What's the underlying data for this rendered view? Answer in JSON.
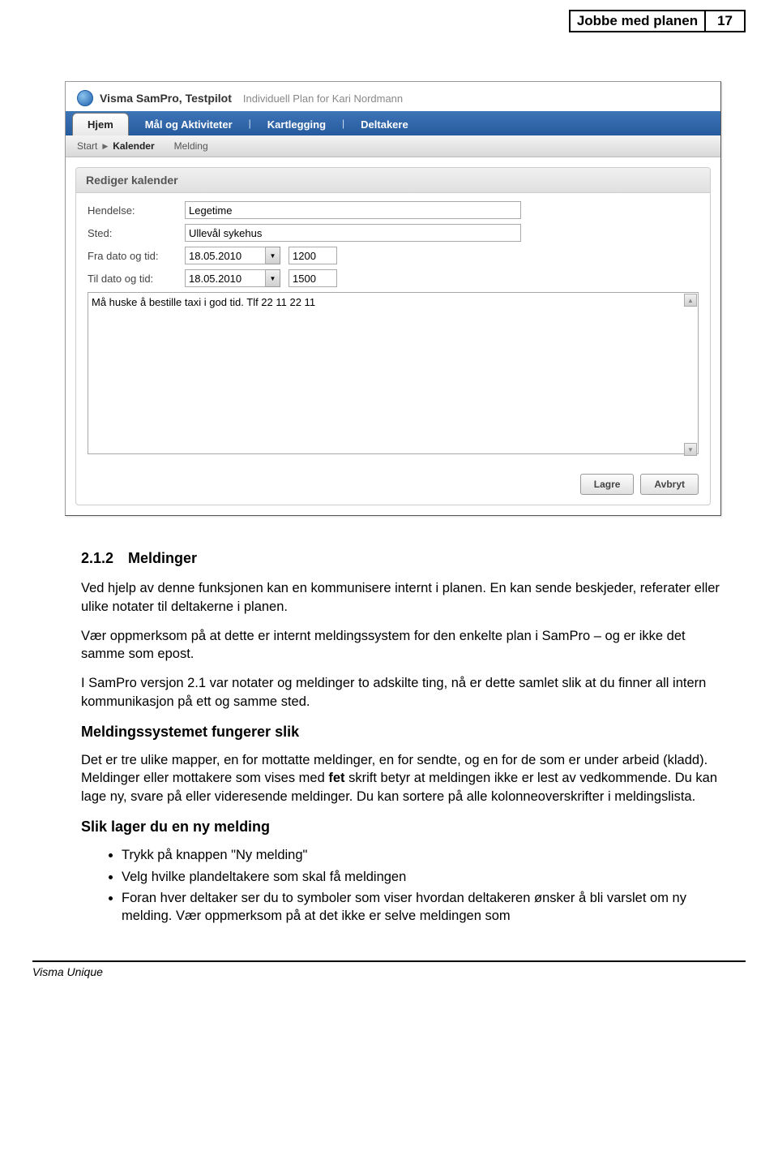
{
  "header": {
    "title": "Jobbe med planen",
    "page_number": "17"
  },
  "app": {
    "name": "Visma SamPro, Testpilot",
    "subtitle": "Individuell Plan for Kari Nordmann",
    "tabs": [
      "Hjem",
      "Mål og Aktiviteter",
      "Kartlegging",
      "Deltakere"
    ],
    "subtabs": {
      "start": "Start",
      "kalender": "Kalender",
      "melding": "Melding"
    }
  },
  "panel": {
    "title": "Rediger kalender",
    "labels": {
      "hendelse": "Hendelse:",
      "sted": "Sted:",
      "fra": "Fra dato og tid:",
      "til": "Til dato og tid:"
    },
    "values": {
      "hendelse": "Legetime",
      "sted": "Ullevål sykehus",
      "fra_date": "18.05.2010",
      "fra_time": "1200",
      "til_date": "18.05.2010",
      "til_time": "1500",
      "notes": "Må huske å bestille taxi i god tid. Tlf 22 11 22 11"
    },
    "buttons": {
      "save": "Lagre",
      "cancel": "Avbryt"
    }
  },
  "doc": {
    "sec_num": "2.1.2",
    "sec_title": "Meldinger",
    "p1": "Ved hjelp av denne funksjonen kan en kommunisere internt i planen. En kan sende beskjeder, referater eller ulike notater til deltakerne i planen.",
    "p2": "Vær oppmerksom på at dette er internt meldingssystem for den enkelte plan i SamPro – og er ikke det samme som epost.",
    "p3": "I SamPro versjon 2.1 var notater og meldinger to adskilte ting, nå er dette samlet slik at du finner all intern kommunikasjon på ett og samme sted.",
    "h2": "Meldingssystemet fungerer slik",
    "p4a": "Det er tre ulike mapper, en for mottatte meldinger, en for sendte, og en for de som er under arbeid (kladd). Meldinger eller mottakere som vises med ",
    "p4b": "fet",
    "p4c": " skrift betyr at meldingen ikke er lest av vedkommende.  Du kan lage ny, svare på eller videresende meldinger. Du kan sortere på alle kolonneoverskrifter i meldingslista.",
    "h3": "Slik lager du en ny melding",
    "bullets": {
      "b1": "Trykk på knappen \"Ny melding\"",
      "b2": "Velg hvilke plandeltakere som skal få meldingen",
      "b3": "Foran hver deltaker ser du to symboler som viser hvordan deltakeren ønsker å bli varslet om ny melding.  Vær oppmerksom på at det ikke er selve meldingen som"
    }
  },
  "footer": "Visma Unique"
}
